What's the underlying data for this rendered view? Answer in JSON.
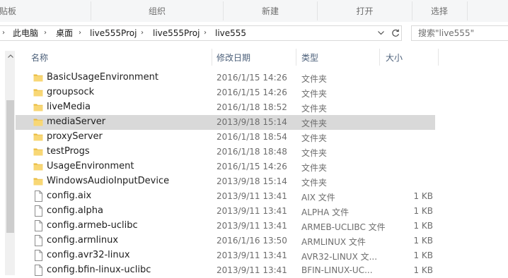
{
  "ribbon": {
    "groups": [
      {
        "label": "贴板"
      },
      {
        "label": "组织"
      },
      {
        "label": "新建"
      },
      {
        "label": "打开"
      },
      {
        "label": "选择"
      }
    ]
  },
  "address": {
    "crumbs": [
      "此电脑",
      "桌面",
      "live555Proj",
      "live555Proj",
      "live555"
    ],
    "search_placeholder": "搜索\"live555\""
  },
  "columns": {
    "name": "名称",
    "date": "修改日期",
    "type": "类型",
    "size": "大小"
  },
  "files": [
    {
      "name": "BasicUsageEnvironment",
      "date": "2016/1/15 14:26",
      "type": "文件夹",
      "size": "",
      "kind": "folder"
    },
    {
      "name": "groupsock",
      "date": "2016/1/15 14:26",
      "type": "文件夹",
      "size": "",
      "kind": "folder"
    },
    {
      "name": "liveMedia",
      "date": "2016/1/18 18:52",
      "type": "文件夹",
      "size": "",
      "kind": "folder"
    },
    {
      "name": "mediaServer",
      "date": "2013/9/18 15:14",
      "type": "文件夹",
      "size": "",
      "kind": "folder",
      "selected": true
    },
    {
      "name": "proxyServer",
      "date": "2016/1/18 18:54",
      "type": "文件夹",
      "size": "",
      "kind": "folder"
    },
    {
      "name": "testProgs",
      "date": "2016/1/18 18:48",
      "type": "文件夹",
      "size": "",
      "kind": "folder"
    },
    {
      "name": "UsageEnvironment",
      "date": "2016/1/15 14:26",
      "type": "文件夹",
      "size": "",
      "kind": "folder"
    },
    {
      "name": "WindowsAudioInputDevice",
      "date": "2013/9/18 15:14",
      "type": "文件夹",
      "size": "",
      "kind": "folder"
    },
    {
      "name": "config.aix",
      "date": "2013/9/11 13:41",
      "type": "AIX 文件",
      "size": "1 KB",
      "kind": "file"
    },
    {
      "name": "config.alpha",
      "date": "2013/9/11 13:41",
      "type": "ALPHA 文件",
      "size": "1 KB",
      "kind": "file"
    },
    {
      "name": "config.armeb-uclibc",
      "date": "2013/9/11 13:41",
      "type": "ARMEB-UCLIBC 文件",
      "size": "1 KB",
      "kind": "file"
    },
    {
      "name": "config.armlinux",
      "date": "2016/1/16 13:50",
      "type": "ARMLINUX 文件",
      "size": "1 KB",
      "kind": "file"
    },
    {
      "name": "config.avr32-linux",
      "date": "2013/9/11 13:41",
      "type": "AVR32-LINUX 文...",
      "size": "1 KB",
      "kind": "file"
    },
    {
      "name": "config.bfin-linux-uclibc",
      "date": "2013/9/11 13:41",
      "type": "BFIN-LINUX-UC...",
      "size": "1 KB",
      "kind": "file"
    }
  ],
  "colors": {
    "folder": "#f2c94c",
    "selected_row": "#d9d9d9",
    "header_text": "#4c607a"
  }
}
